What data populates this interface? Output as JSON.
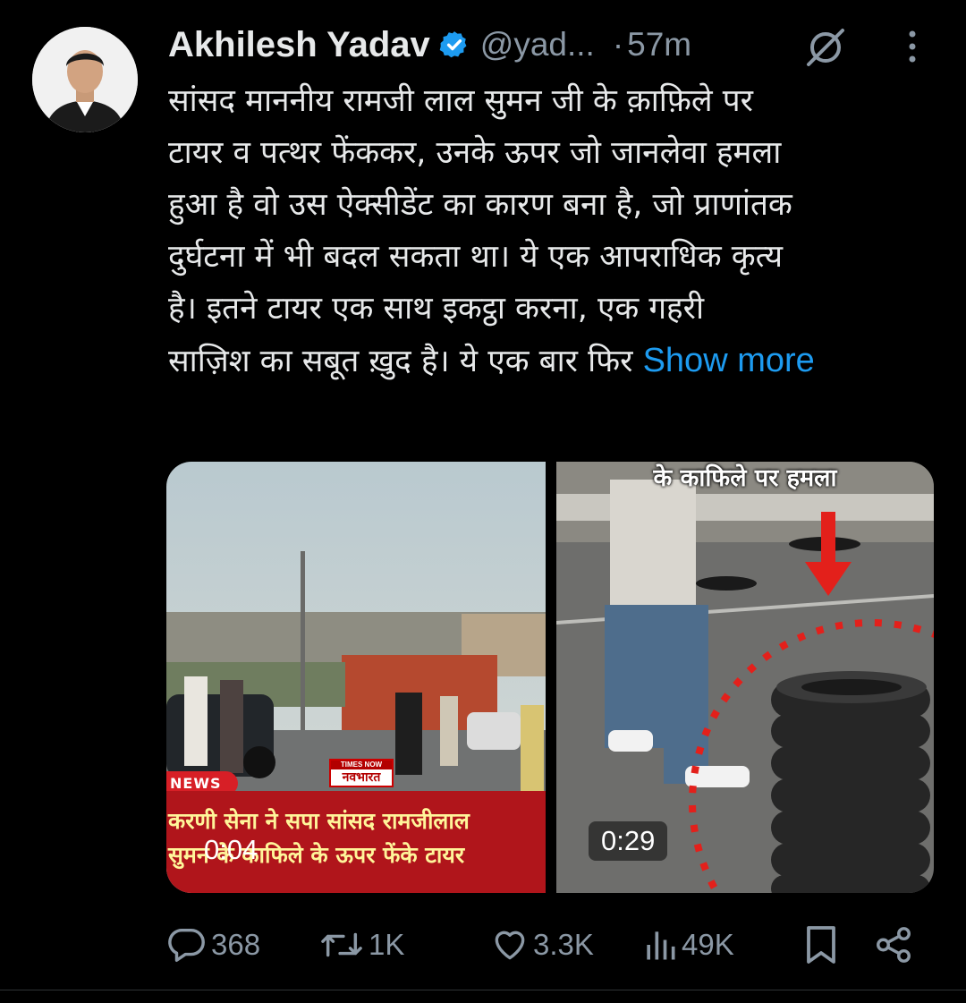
{
  "tweet": {
    "author_name": "Akhilesh Yadav",
    "handle": "@yad...",
    "separator": "·",
    "time": "57m",
    "text_lines": [
      "सांसद माननीय रामजी लाल सुमन जी के क़ाफ़िले पर",
      "टायर व पत्थर फेंककर, उनके ऊपर जो जानलेवा हमला",
      "हुआ है वो उस ऐक्सीडेंट का कारण बना है, जो प्राणांतक",
      "दुर्घटना में भी बदल सकता था। ये एक आपराधिक कृत्य",
      "है। इतने टायर एक साथ इकट्ठा करना, एक गहरी",
      "साज़िश का सबूत ख़ुद है। ये एक बार फिर"
    ],
    "show_more_label": "Show more",
    "icons": {
      "verified": "verified-badge-icon",
      "grok": "grok-icon",
      "more": "more-vertical-icon"
    },
    "accent_color": "#1d9bf0"
  },
  "media": {
    "left_video": {
      "news_tag": "NEWS",
      "channel_top": "TIMES NOW",
      "channel_bottom": "नवभारत",
      "caption_line1": "करणी सेना ने सपा सांसद रामजीलाल",
      "caption_line2": "सुमन के काफिले के ऊपर फेंके टायर",
      "duration": "0:04"
    },
    "right_video": {
      "banner": "के काफिले पर हमला",
      "duration": "0:29"
    }
  },
  "actions": {
    "reply_count": "368",
    "retweet_count": "1K",
    "like_count": "3.3K",
    "views_count": "49K",
    "icons": [
      "reply-icon",
      "retweet-icon",
      "like-icon",
      "views-icon",
      "bookmark-icon",
      "share-icon"
    ]
  }
}
